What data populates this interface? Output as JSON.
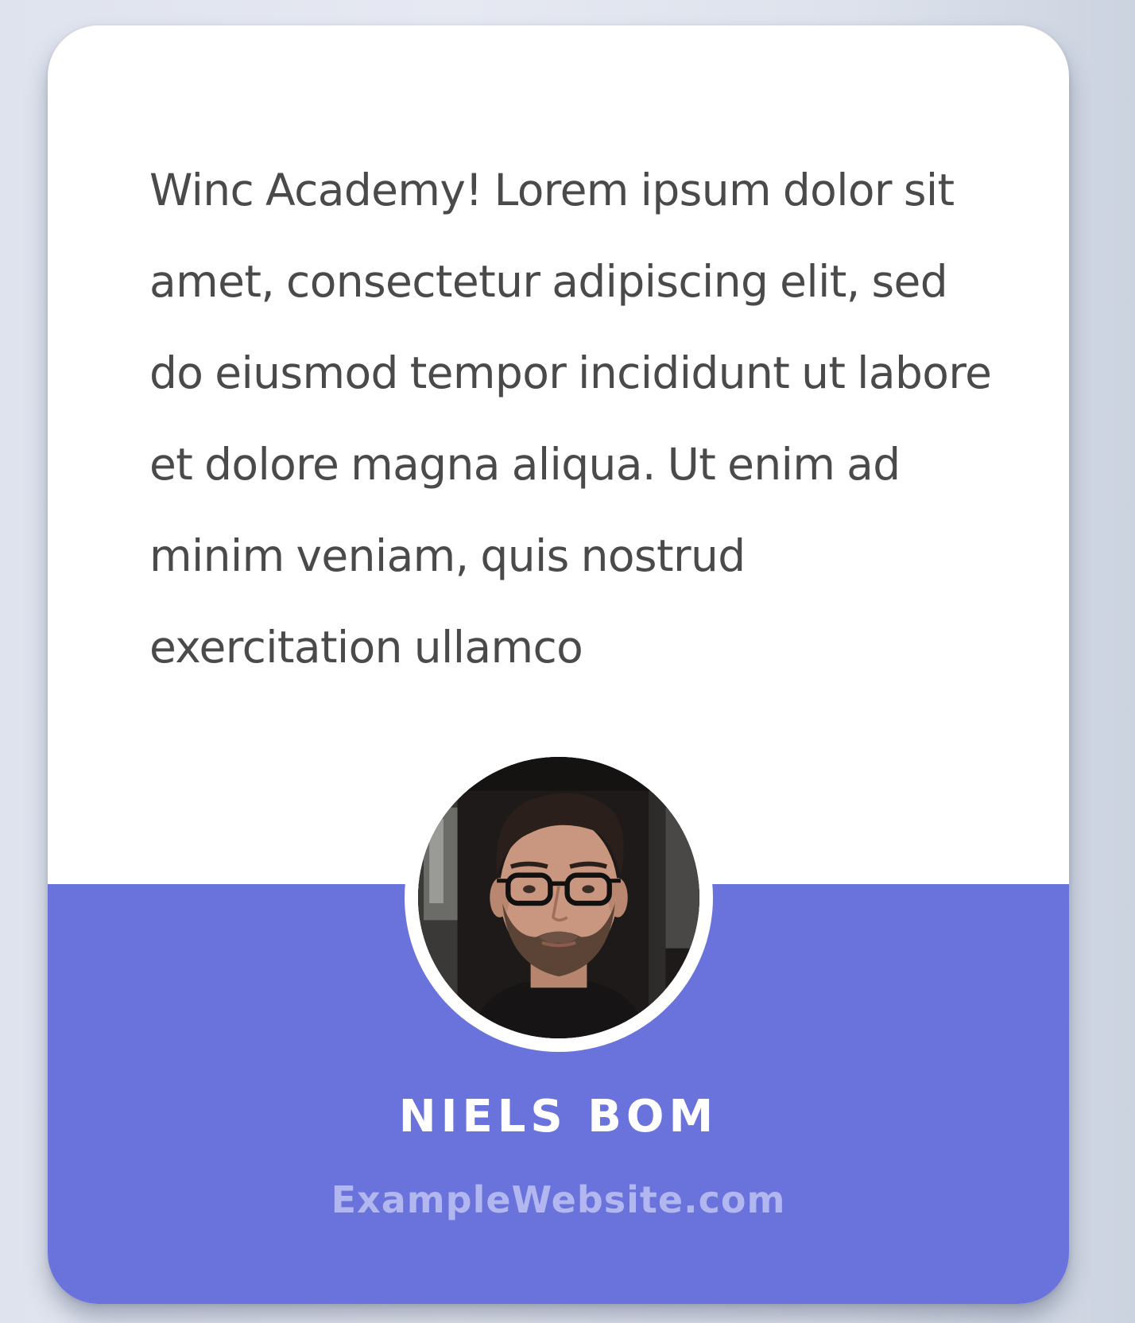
{
  "testimonial": {
    "quote": "Winc Academy! Lorem ipsum dolor sit amet, consectetur adipiscing elit, sed do eiusmod tempor incididunt ut labore et dolore magna aliqua. Ut enim ad minim veniam, quis nostrud exercitation ullamco",
    "author_name": "NIELS BOM",
    "author_website": "ExampleWebsite.com",
    "avatar": "user-photo"
  },
  "colors": {
    "accent": "#6a72db",
    "card_background": "#ffffff",
    "quote_text": "#4a4a4a",
    "website_text": "#b3b7ef"
  }
}
